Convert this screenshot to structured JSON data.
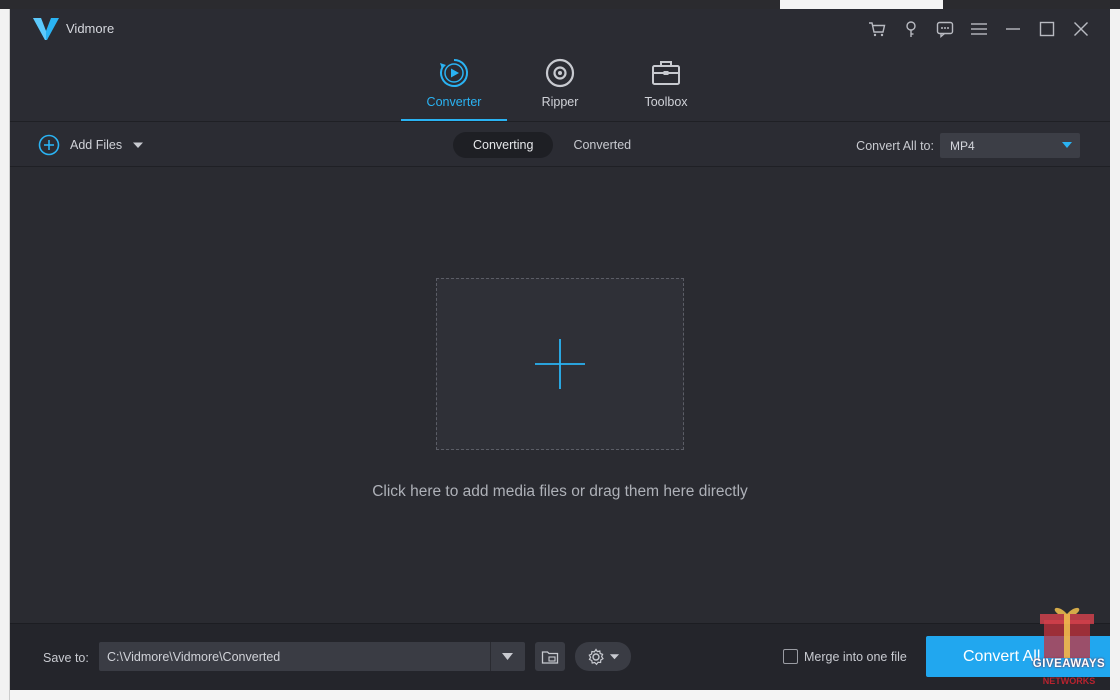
{
  "app": {
    "name": "Vidmore",
    "colors": {
      "accent": "#21a7ef",
      "background": "#2b2c33",
      "panel": "#24252b"
    }
  },
  "window_controls": [
    {
      "icon": "cart-icon"
    },
    {
      "icon": "key-icon"
    },
    {
      "icon": "feedback-icon"
    },
    {
      "icon": "menu-icon"
    },
    {
      "icon": "minimize-icon"
    },
    {
      "icon": "maximize-icon"
    },
    {
      "icon": "close-icon"
    }
  ],
  "nav": {
    "converter": "Converter",
    "ripper": "Ripper",
    "toolbox": "Toolbox",
    "active": "converter"
  },
  "toolbar": {
    "add_files": "Add Files",
    "tab_converting": "Converting",
    "tab_converted": "Converted",
    "active_tab": "converting",
    "convert_all_label": "Convert All to:",
    "format_selected": "MP4"
  },
  "main": {
    "hint": "Click here to add media files or drag them here directly"
  },
  "footer": {
    "save_to_label": "Save to:",
    "save_path": "C:\\Vidmore\\Vidmore\\Converted",
    "merge_label": "Merge into one file",
    "merge_checked": false,
    "convert_button": "Convert All"
  },
  "watermark": {
    "line1": "GIVEAWAYS",
    "line2": "NETWORKS"
  }
}
